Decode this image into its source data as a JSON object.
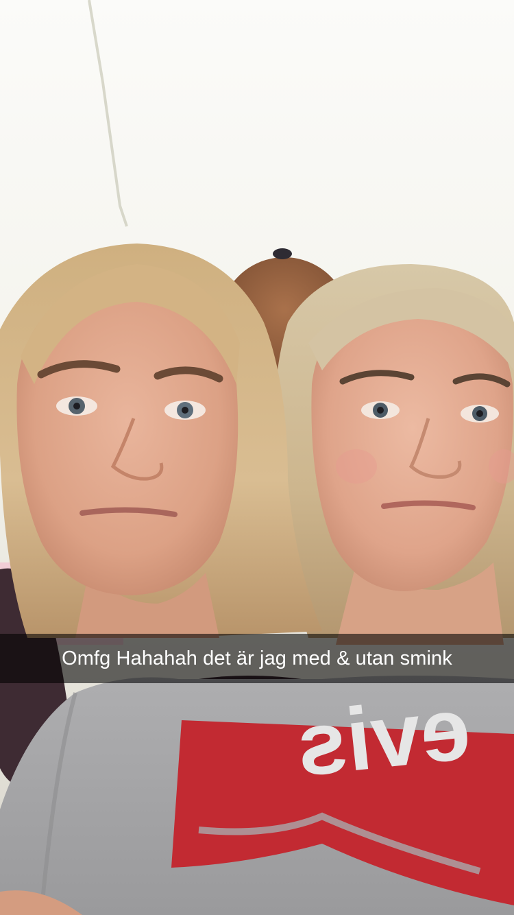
{
  "snap": {
    "caption": "Omfg Hahahah det är jag med & utan smink",
    "shirt_print": "evis"
  },
  "colors": {
    "caption_bar": "#000000",
    "caption_text": "#ffffff",
    "shirt_logo_red": "#c22a32",
    "shirt_grey": "#a9a9ab",
    "hair_blonde": "#d4b98e",
    "background_wall": "#f6f4ee"
  },
  "icons": {
    "teddy_bear": "teddy-bear-shape"
  }
}
